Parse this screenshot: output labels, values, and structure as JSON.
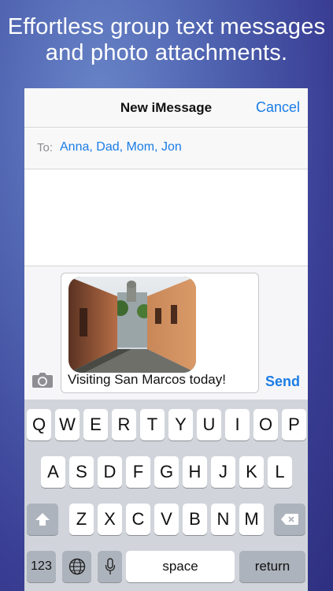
{
  "promo": {
    "line1": "Effortless group text messages",
    "line2": "and photo attachments."
  },
  "navbar": {
    "title": "New iMessage",
    "cancel": "Cancel"
  },
  "recipients": {
    "label": "To:",
    "value": "Anna, Dad, Mom, Jon"
  },
  "compose": {
    "message": "Visiting San Marcos today!",
    "send": "Send",
    "photo_icon": "camera-icon"
  },
  "keyboard": {
    "row1": [
      "Q",
      "W",
      "E",
      "R",
      "T",
      "Y",
      "U",
      "I",
      "O",
      "P"
    ],
    "row2": [
      "A",
      "S",
      "D",
      "F",
      "G",
      "H",
      "J",
      "K",
      "L"
    ],
    "row3": [
      "Z",
      "X",
      "C",
      "V",
      "B",
      "N",
      "M"
    ],
    "numbers": "123",
    "space": "space",
    "return": "return",
    "icons": [
      "shift-icon",
      "delete-icon",
      "globe-icon",
      "microphone-icon"
    ]
  },
  "colors": {
    "accent": "#1a7ce6",
    "background": "#4f63b0"
  }
}
